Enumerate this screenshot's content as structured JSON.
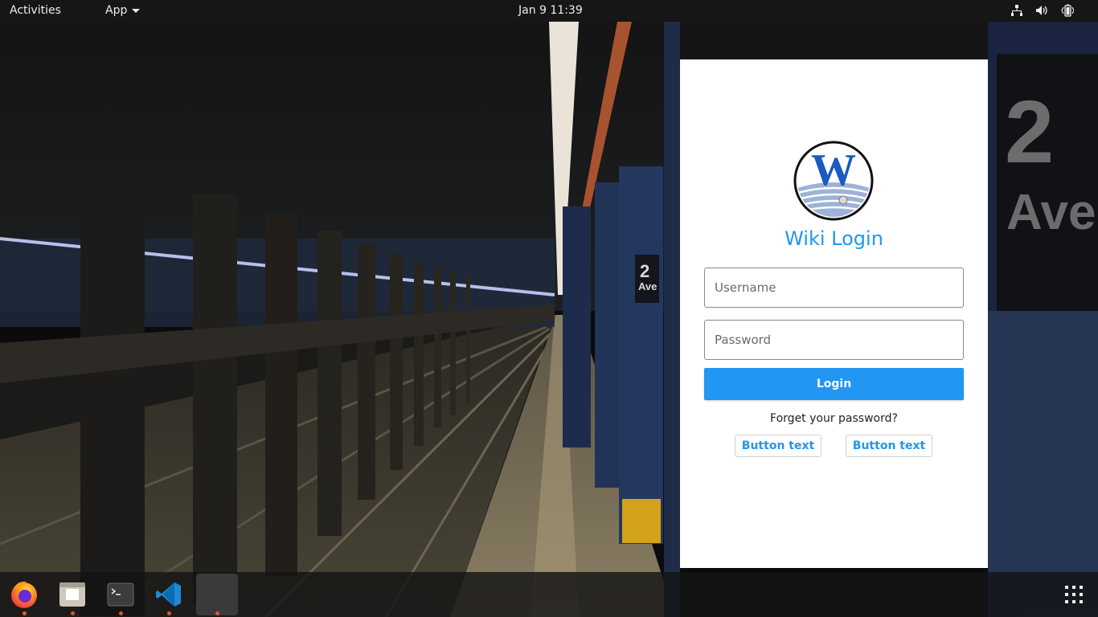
{
  "topbar": {
    "activities": "Activities",
    "app_menu": "App",
    "clock": "Jan 9  11:39",
    "icons": [
      "network-icon",
      "volume-icon",
      "battery-icon"
    ]
  },
  "login": {
    "title": "Wiki Login",
    "logo_letter": "W",
    "username_placeholder": "Username",
    "password_placeholder": "Password",
    "login_label": "Login",
    "forgot_label": "Forget your password?",
    "button1_label": "Button text",
    "button2_label": "Button text",
    "accent": "#2196f3"
  },
  "wallpaper": {
    "sign_number": "2",
    "sign_text": "Ave",
    "sign_small_number": "2",
    "sign_small_text": "Ave"
  },
  "dock": {
    "items": [
      "firefox-icon",
      "files-icon",
      "terminal-icon",
      "vscode-icon",
      "blank-app-icon"
    ],
    "show_apps_icon": "app-grid-icon"
  }
}
